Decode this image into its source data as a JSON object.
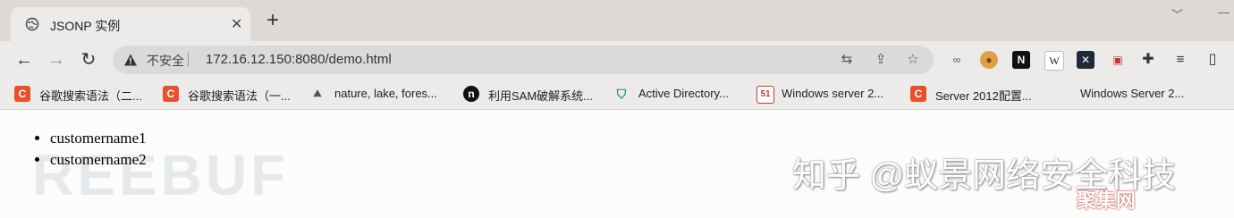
{
  "tab": {
    "title": "JSONP 实例",
    "close": "✕",
    "new_tab": "+"
  },
  "window_controls": {
    "minimize": "—",
    "chevron": "﹀"
  },
  "toolbar": {
    "insecure_label": "不安全",
    "url": "172.16.12.150:8080/demo.html"
  },
  "bookmarks": [
    {
      "label": "谷歌搜索语法（二...",
      "icon": "C",
      "color": "#e8512d"
    },
    {
      "label": "谷歌搜索语法（一...",
      "icon": "C",
      "color": "#e8512d"
    },
    {
      "label": "nature, lake, fores...",
      "icon": "pic",
      "color": "#777777"
    },
    {
      "label": "利用SAM破解系统...",
      "icon": "n",
      "color": "#111111"
    },
    {
      "label": "Active Directory...",
      "icon": "shield",
      "color": "#2b8a8a"
    },
    {
      "label": "Windows server 2...",
      "icon": "51",
      "color": "#c0392b"
    },
    {
      "label": "Server 2012配置...",
      "icon": "C",
      "color": "#e8512d"
    },
    {
      "label": "Windows Server 2...",
      "icon": "blank",
      "color": "#dddddd"
    }
  ],
  "content": {
    "items": [
      "customername1",
      "customername2"
    ]
  },
  "watermarks": {
    "freebuf": "REEBUF",
    "zhihu": "知乎 @蚁景网络安全科技",
    "jjw": "聚集网"
  }
}
